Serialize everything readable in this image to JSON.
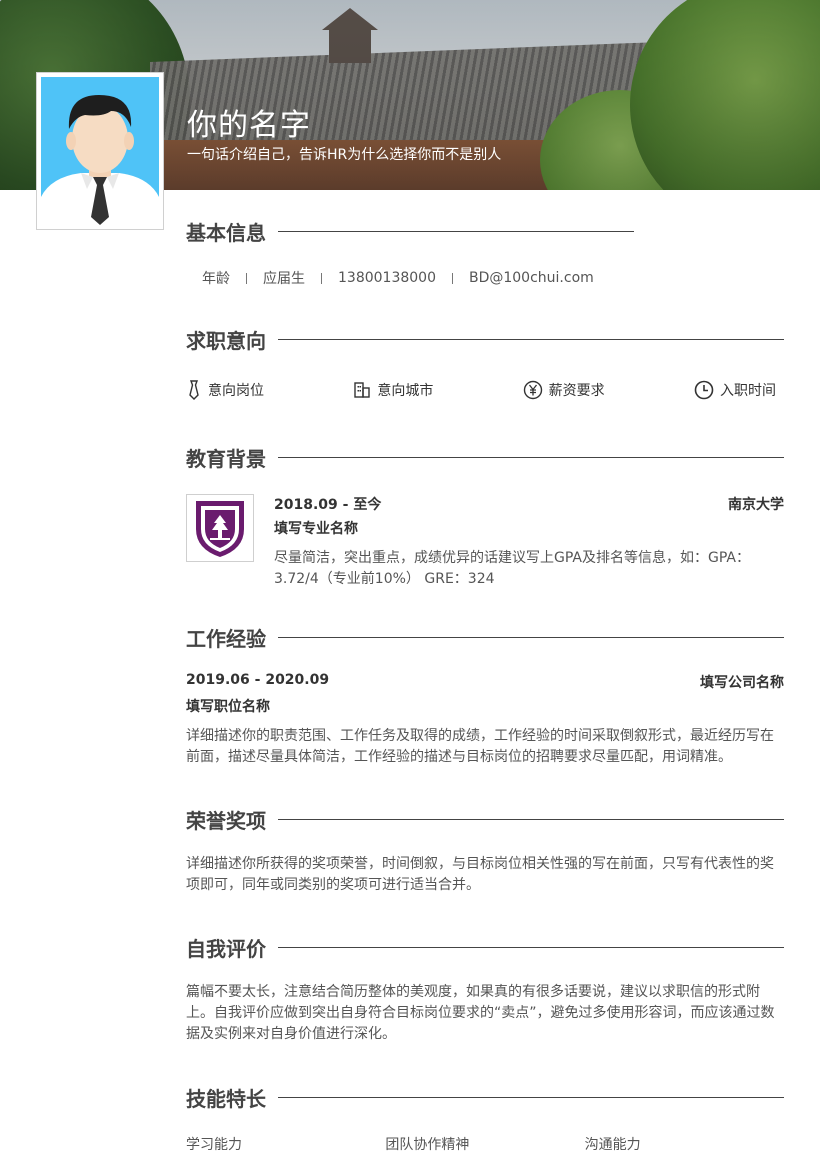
{
  "header": {
    "name": "你的名字",
    "tagline": "一句话介绍自己，告诉HR为什么选择你而不是别人"
  },
  "basic": {
    "title": "基本信息",
    "items": [
      "年龄",
      "应届生",
      "13800138000",
      "BD@100chui.com"
    ]
  },
  "intent": {
    "title": "求职意向",
    "items": [
      {
        "icon": "tie-icon",
        "label": "意向岗位"
      },
      {
        "icon": "building-icon",
        "label": "意向城市"
      },
      {
        "icon": "yuan-icon",
        "label": "薪资要求"
      },
      {
        "icon": "clock-icon",
        "label": "入职时间"
      }
    ]
  },
  "education": {
    "title": "教育背景",
    "date": "2018.09 - 至今",
    "school": "南京大学",
    "major": "填写专业名称",
    "desc": "尽量简洁，突出重点，成绩优异的话建议写上GPA及排名等信息，如：GPA：3.72/4（专业前10%） GRE：324"
  },
  "work": {
    "title": "工作经验",
    "date": "2019.06 - 2020.09",
    "company": "填写公司名称",
    "position": "填写职位名称",
    "desc": "详细描述你的职责范围、工作任务及取得的成绩，工作经验的时间采取倒叙形式，最近经历写在前面，描述尽量具体简洁，工作经验的描述与目标岗位的招聘要求尽量匹配，用词精准。"
  },
  "honors": {
    "title": "荣誉奖项",
    "desc": "详细描述你所获得的奖项荣誉，时间倒叙，与目标岗位相关性强的写在前面，只写有代表性的奖项即可，同年或同类别的奖项可进行适当合并。"
  },
  "self": {
    "title": "自我评价",
    "desc": "篇幅不要太长，注意结合简历整体的美观度，如果真的有很多话要说，建议以求职信的形式附上。自我评价应做到突出自身符合目标岗位要求的“卖点”，避免过多使用形容词，而应该通过数据及实例来对自身价值进行深化。"
  },
  "skills": {
    "title": "技能特长",
    "items": [
      "学习能力",
      "团队协作精神",
      "沟通能力"
    ]
  },
  "colors": {
    "accent": "#444444",
    "photo_bg": "#4fc3f7",
    "logo_purple": "#6a1b6e"
  }
}
